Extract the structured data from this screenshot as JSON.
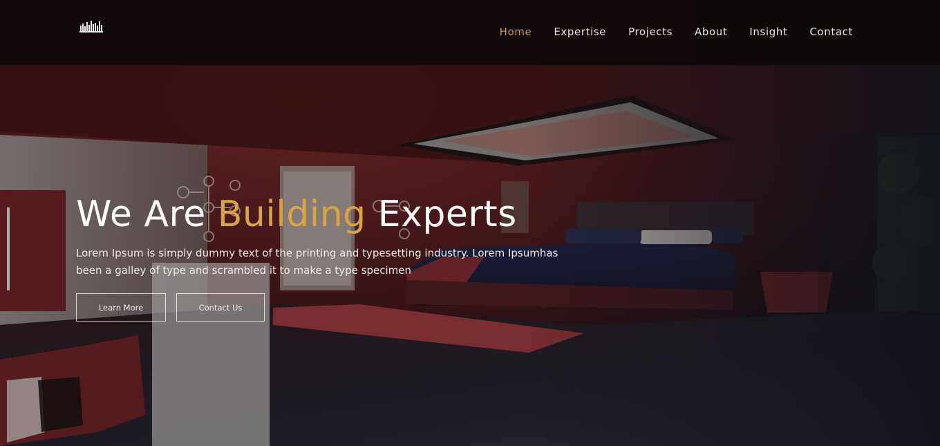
{
  "header": {
    "logo_icon": "city-skyline-icon",
    "nav": [
      {
        "label": "Home",
        "active": true
      },
      {
        "label": "Expertise",
        "active": false
      },
      {
        "label": "Projects",
        "active": false
      },
      {
        "label": "About",
        "active": false
      },
      {
        "label": "Insight",
        "active": false
      },
      {
        "label": "Contact",
        "active": false
      }
    ]
  },
  "hero": {
    "title_part1": "We Are ",
    "title_accent": "Building",
    "title_part2": " Experts",
    "subtitle": "Lorem Ipsum is simply dummy text of the printing and typesetting industry. Lorem Ipsumhas been a galley of type and scrambled it to make a type specimen",
    "learn_more_label": "Learn More",
    "contact_label": "Contact Us"
  },
  "colors": {
    "accent": "#d9a441",
    "nav_active": "#c9945f",
    "header_bg": "#0e0809"
  }
}
